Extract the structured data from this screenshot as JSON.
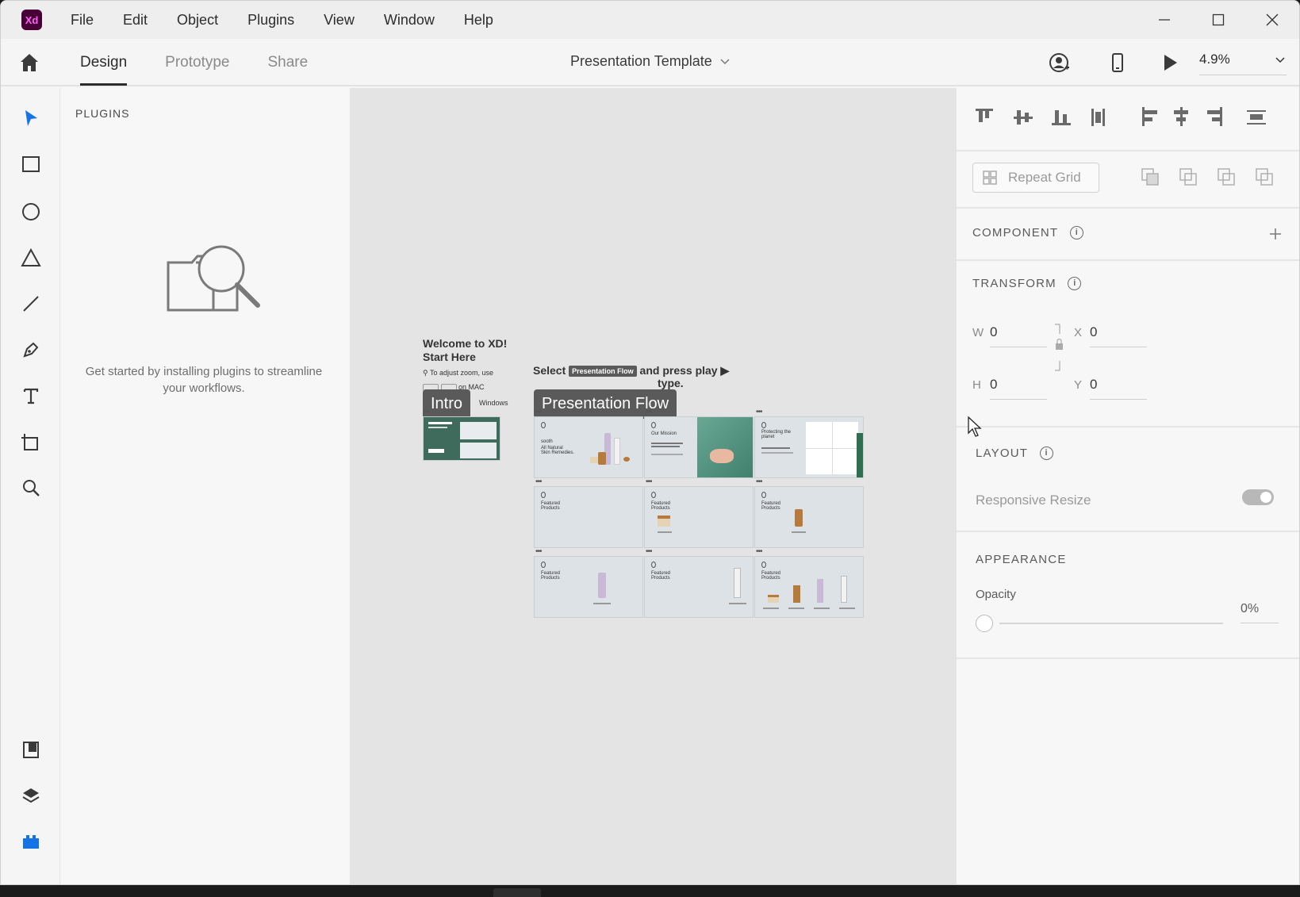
{
  "app": {
    "logo_text": "Xd",
    "brand_color": "#470137"
  },
  "menu": [
    "File",
    "Edit",
    "Object",
    "Plugins",
    "View",
    "Window",
    "Help"
  ],
  "tabs": [
    {
      "label": "Design",
      "active": true
    },
    {
      "label": "Prototype",
      "active": false
    },
    {
      "label": "Share",
      "active": false
    }
  ],
  "document": {
    "title": "Presentation Template"
  },
  "zoom": {
    "value": "4.9%"
  },
  "plugins": {
    "title": "PLUGINS",
    "empty_message": "Get started by installing plugins to streamline your workflows."
  },
  "canvas": {
    "welcome_title_1": "Welcome to XD!",
    "welcome_title_2": "Start Here",
    "zoom_hint": "To adjust zoom, use",
    "mac_hint": "on MAC",
    "win_hint": "Windows",
    "select_text_1": "Select",
    "select_badge": "Presentation Flow",
    "select_text_2": "and press play ▶",
    "select_text_3": "type.",
    "flow_intro": "Intro",
    "flow_presentation": "Presentation Flow",
    "ab_soothe": "sooth",
    "ab_natural": "All Natural",
    "ab_skin": "Skin Remedies.",
    "ab_mission": "Our Mission",
    "ab_planet_1": "Protecting the",
    "ab_planet_2": "planet",
    "ab_featured": "Featured",
    "ab_products": "Products"
  },
  "right_panel": {
    "repeat_grid": "Repeat Grid",
    "component_title": "COMPONENT",
    "transform_title": "TRANSFORM",
    "w_label": "W",
    "w_value": "0",
    "h_label": "H",
    "h_value": "0",
    "x_label": "X",
    "x_value": "0",
    "y_label": "Y",
    "y_value": "0",
    "layout_title": "LAYOUT",
    "responsive_resize": "Responsive Resize",
    "appearance_title": "APPEARANCE",
    "opacity_label": "Opacity",
    "opacity_value": "0%"
  },
  "colors": {
    "accent": "#1473e6",
    "panel": "#f7f7f7",
    "canvas": "#e4e4e4",
    "flow_badge": "#5a5a5a",
    "artboard_green": "#3f6b5c"
  }
}
